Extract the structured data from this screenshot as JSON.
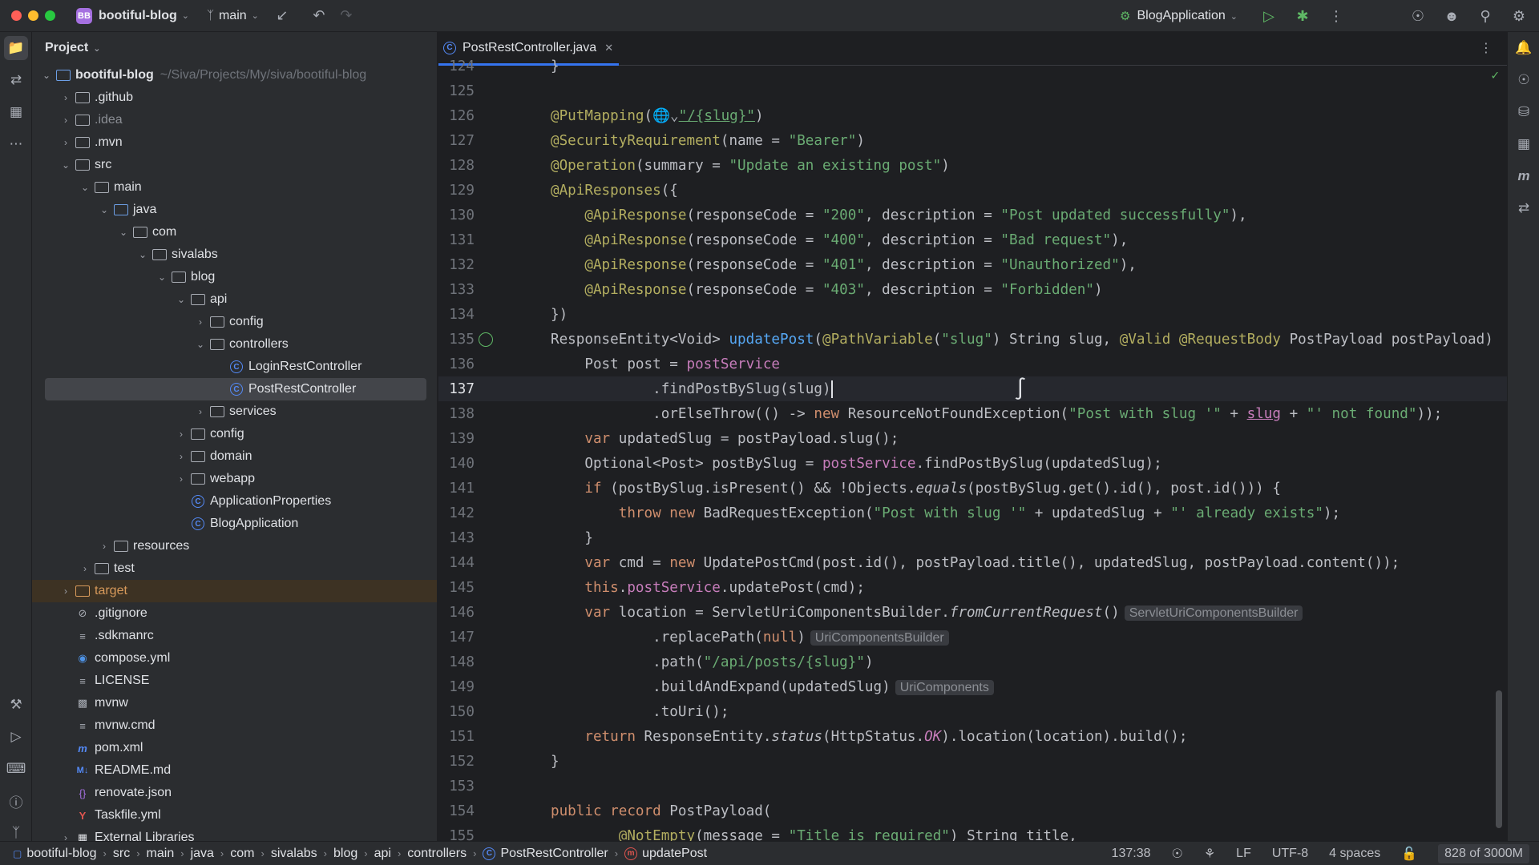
{
  "titlebar": {
    "project_badge": "BB",
    "project_name": "bootiful-blog",
    "branch": "main",
    "run_config": "BlogApplication"
  },
  "project_panel": {
    "title": "Project",
    "root_name": "bootiful-blog",
    "root_path": "~/Siva/Projects/My/siva/bootiful-blog",
    "items": [
      {
        "label": ".github"
      },
      {
        "label": ".idea"
      },
      {
        "label": ".mvn"
      },
      {
        "label": "src"
      },
      {
        "label": "main"
      },
      {
        "label": "java"
      },
      {
        "label": "com"
      },
      {
        "label": "sivalabs"
      },
      {
        "label": "blog"
      },
      {
        "label": "api"
      },
      {
        "label": "config"
      },
      {
        "label": "controllers"
      },
      {
        "label": "LoginRestController"
      },
      {
        "label": "PostRestController"
      },
      {
        "label": "services"
      },
      {
        "label": "config"
      },
      {
        "label": "domain"
      },
      {
        "label": "webapp"
      },
      {
        "label": "ApplicationProperties"
      },
      {
        "label": "BlogApplication"
      },
      {
        "label": "resources"
      },
      {
        "label": "test"
      },
      {
        "label": "target"
      },
      {
        "label": ".gitignore"
      },
      {
        "label": ".sdkmanrc"
      },
      {
        "label": "compose.yml"
      },
      {
        "label": "LICENSE"
      },
      {
        "label": "mvnw"
      },
      {
        "label": "mvnw.cmd"
      },
      {
        "label": "pom.xml"
      },
      {
        "label": "README.md"
      },
      {
        "label": "renovate.json"
      },
      {
        "label": "Taskfile.yml"
      },
      {
        "label": "External Libraries"
      }
    ]
  },
  "editor": {
    "tab_label": "PostRestController.java",
    "line_numbers": [
      "124",
      "125",
      "126",
      "127",
      "128",
      "129",
      "130",
      "131",
      "132",
      "133",
      "134",
      "135",
      "136",
      "137",
      "138",
      "139",
      "140",
      "141",
      "142",
      "143",
      "144",
      "145",
      "146",
      "147",
      "148",
      "149",
      "150",
      "151",
      "152",
      "153",
      "154",
      "155"
    ],
    "hints": {
      "h146": "ServletUriComponentsBuilder",
      "h147": "UriComponentsBuilder",
      "h149": "UriComponents"
    }
  },
  "statusbar": {
    "crumbs": [
      "bootiful-blog",
      "src",
      "main",
      "java",
      "com",
      "sivalabs",
      "blog",
      "api",
      "controllers",
      "PostRestController",
      "updatePost"
    ],
    "position": "137:38",
    "line_sep": "LF",
    "encoding": "UTF-8",
    "indent": "4 spaces",
    "memory": "828 of 3000M"
  }
}
